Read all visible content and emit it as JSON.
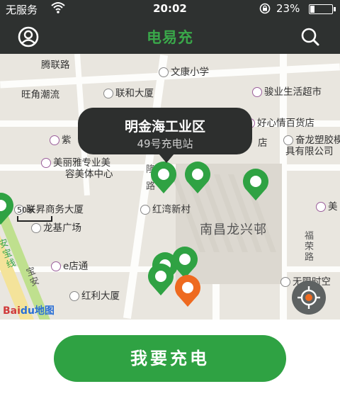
{
  "status_bar": {
    "carrier": "无服务",
    "time": "20:02",
    "battery": "23%",
    "battery_level": 0.23
  },
  "header": {
    "title": "电易充",
    "left_icon": "user-icon",
    "right_icon": "search-icon"
  },
  "map": {
    "pois": [
      {
        "name": "腾联路",
        "icon": "none"
      },
      {
        "name": "文康小学",
        "icon": "school-icon"
      },
      {
        "name": "旺角潮流",
        "icon": "none"
      },
      {
        "name": "联和大厦",
        "icon": "building-icon"
      },
      {
        "name": "骏业生活超市",
        "icon": "shop-icon"
      },
      {
        "name": "好心情百货店",
        "icon": "shop-icon"
      },
      {
        "name": "紫",
        "icon": "shop-icon"
      },
      {
        "name": "奋龙塑胶模",
        "icon": "building-icon"
      },
      {
        "name": "具有限公司",
        "icon": "none"
      },
      {
        "name": "店",
        "icon": "none"
      },
      {
        "name": "美丽雅专业美",
        "icon": "shop-icon"
      },
      {
        "name": "容美体中心",
        "icon": "none"
      },
      {
        "name": "联昇商务大厦",
        "icon": "building-icon"
      },
      {
        "name": "红湾新村",
        "icon": "building-icon"
      },
      {
        "name": "美",
        "icon": "shop-icon"
      },
      {
        "name": "龙基广场",
        "icon": "building-icon"
      },
      {
        "name": "e店通",
        "icon": "shop-icon"
      },
      {
        "name": "红利大厦",
        "icon": "building-icon"
      },
      {
        "name": "无限时空",
        "icon": "building-icon"
      }
    ],
    "area_label": "南昌龙兴邨",
    "streets": [
      {
        "name": "福荣路"
      },
      {
        "name": "宝安"
      },
      {
        "name": "安宝线"
      },
      {
        "name": "隆"
      },
      {
        "name": "路"
      }
    ],
    "scale": "50米",
    "logo_bai": "Bai",
    "logo_du": "du",
    "logo_map": "地图",
    "tooltip": {
      "title": "明金海工业区",
      "subtitle": "49号充电站"
    },
    "pins": [
      {
        "color": "#2fa243"
      },
      {
        "color": "#2fa243"
      },
      {
        "color": "#2fa243"
      },
      {
        "color": "#2fa243"
      },
      {
        "color": "#2fa243"
      },
      {
        "color": "#2fa243"
      },
      {
        "color": "#2fa243"
      },
      {
        "color": "#ee6a20"
      }
    ]
  },
  "action": {
    "charge_button": "我要充电"
  },
  "colors": {
    "brand": "#2fa243",
    "header_bg": "#2e3130",
    "alert_pin": "#ee6a20"
  }
}
